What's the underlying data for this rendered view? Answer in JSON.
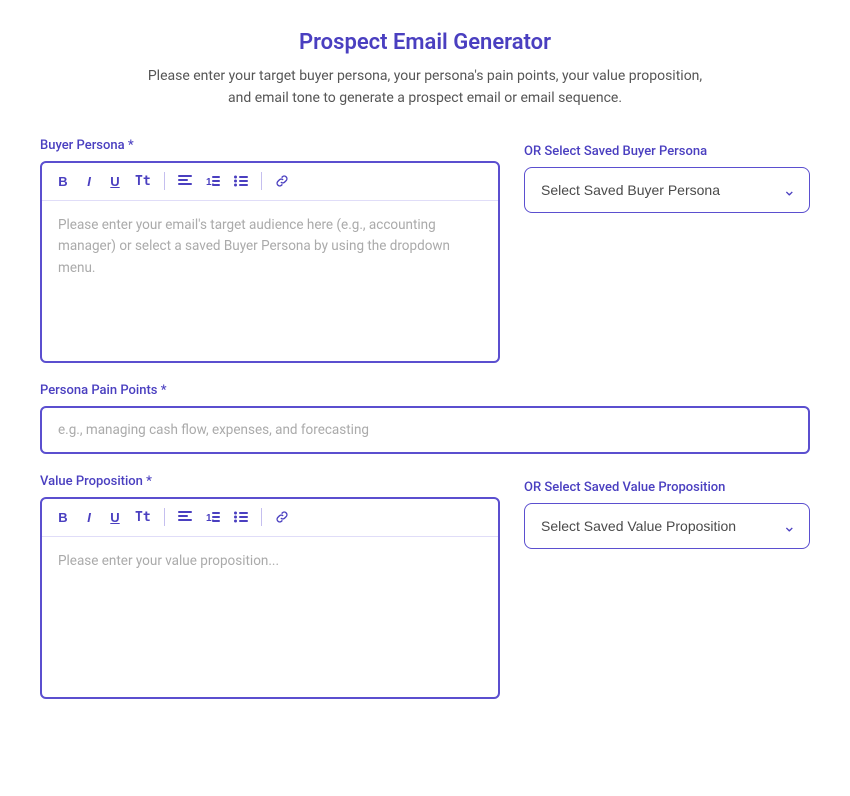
{
  "header": {
    "title": "Prospect Email Generator",
    "subtitle_line1": "Please enter your target buyer persona, your persona's pain points, your value proposition,",
    "subtitle_line2": "and email tone to generate a prospect email or email sequence."
  },
  "buyer_persona": {
    "label": "Buyer Persona *",
    "or_label": "OR Select Saved Buyer Persona",
    "placeholder": "Please enter your email's target audience here (e.g., accounting manager) or select a saved Buyer Persona by using the dropdown menu.",
    "dropdown_placeholder": "Select Saved Buyer Persona",
    "toolbar": {
      "bold": "B",
      "italic": "I",
      "underline": "U",
      "tt": "Tt"
    }
  },
  "persona_pain_points": {
    "label": "Persona Pain Points *",
    "placeholder": "e.g., managing cash flow, expenses, and forecasting"
  },
  "value_proposition": {
    "label": "Value Proposition *",
    "or_label": "OR Select Saved Value Proposition",
    "placeholder": "Please enter your value proposition...",
    "dropdown_placeholder": "Select Saved Value Proposition",
    "toolbar": {
      "bold": "B",
      "italic": "I",
      "underline": "U",
      "tt": "Tt"
    }
  },
  "colors": {
    "primary": "#4a3fc0",
    "border": "#5b4fcf"
  }
}
